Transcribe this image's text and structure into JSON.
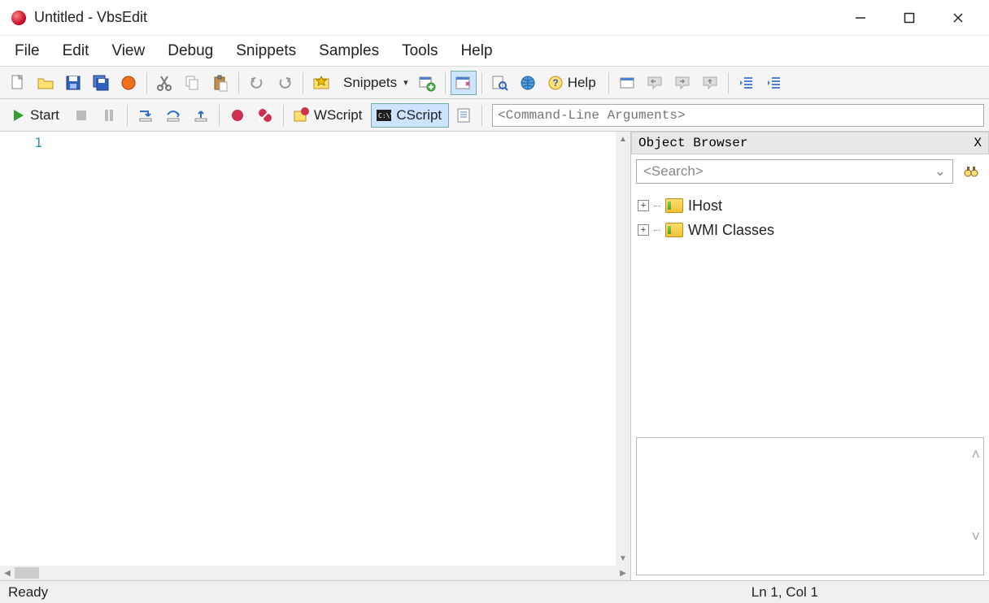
{
  "title": "Untitled - VbsEdit",
  "menu": [
    "File",
    "Edit",
    "View",
    "Debug",
    "Snippets",
    "Samples",
    "Tools",
    "Help"
  ],
  "toolbar": {
    "snippets_label": "Snippets",
    "help_label": "Help"
  },
  "toolbar2": {
    "start_label": "Start",
    "wscript_label": "WScript",
    "cscript_label": "CScript",
    "cmdargs_placeholder": "<Command-Line Arguments>"
  },
  "editor": {
    "line_number": "1"
  },
  "object_browser": {
    "title": "Object Browser",
    "close": "X",
    "search_placeholder": "<Search>",
    "items": [
      "IHost",
      "WMI Classes"
    ]
  },
  "status": {
    "message": "Ready",
    "position": "Ln 1, Col 1"
  }
}
